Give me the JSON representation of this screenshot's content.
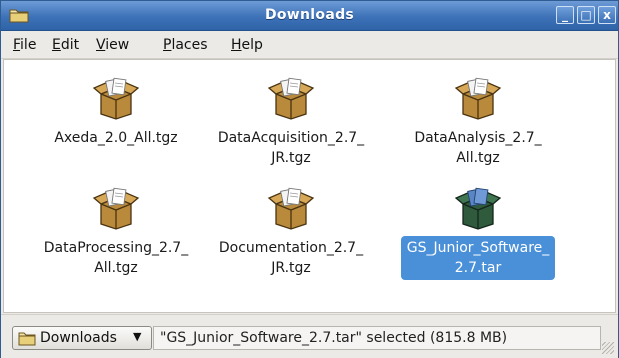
{
  "window": {
    "title": "Downloads",
    "buttons": {
      "minimize": "_",
      "maximize": "□",
      "close": "x"
    }
  },
  "menubar": [
    {
      "label": "File",
      "mnemonic": "F",
      "rest": "ile"
    },
    {
      "label": "Edit",
      "mnemonic": "E",
      "rest": "dit"
    },
    {
      "label": "View",
      "mnemonic": "V",
      "rest": "iew"
    },
    {
      "label": "Places",
      "mnemonic": "P",
      "rest": "laces"
    },
    {
      "label": "Help",
      "mnemonic": "H",
      "rest": "elp"
    }
  ],
  "files": [
    {
      "line1": "Axeda_2.0_All.tgz",
      "line2": "",
      "icon": "package-archive-icon",
      "selected": false
    },
    {
      "line1": "DataAcquisition_2.7_",
      "line2": "JR.tgz",
      "icon": "package-archive-icon",
      "selected": false
    },
    {
      "line1": "DataAnalysis_2.7_",
      "line2": "All.tgz",
      "icon": "package-archive-icon",
      "selected": false
    },
    {
      "line1": "DataProcessing_2.7_",
      "line2": "All.tgz",
      "icon": "package-archive-icon",
      "selected": false
    },
    {
      "line1": "Documentation_2.7_",
      "line2": "JR.tgz",
      "icon": "package-archive-icon",
      "selected": false
    },
    {
      "line1": "GS_Junior_Software_",
      "line2": "2.7.tar",
      "icon": "tar-archive-icon",
      "selected": true
    }
  ],
  "statusbar": {
    "location_label": "Downloads",
    "status_text": "\"GS_Junior_Software_2.7.tar\" selected (815.8 MB)"
  },
  "colors": {
    "titlebar": "#3d72b8",
    "selection": "#4a90d9",
    "package_box": "#b98a3c",
    "tar_box": "#2f5a3c"
  }
}
